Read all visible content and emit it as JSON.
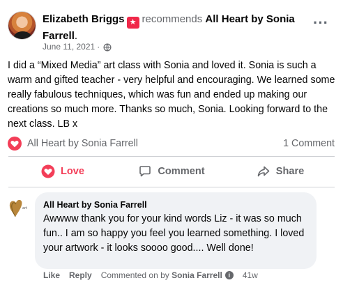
{
  "post": {
    "author_name": "Elizabeth Briggs",
    "verb": "recommends",
    "page_name": "All Heart by Sonia Farrell",
    "period": ".",
    "date": "June 11, 2021",
    "date_sep": "·",
    "body": "I did a “Mixed Media” art class with Sonia and loved it. Sonia is such a warm and gifted teacher - very helpful and encouraging. We learned some really fabulous techniques, which was fun and ended up making our creations so much more. Thanks so much, Sonia. Looking forward to the next class. LB x"
  },
  "stats": {
    "reactor": "All Heart by Sonia Farrell",
    "comment_count": "1 Comment"
  },
  "actions": {
    "love": "Love",
    "comment": "Comment",
    "share": "Share"
  },
  "comment": {
    "author": "All Heart by Sonia Farrell",
    "text": "Awwww thank you for your kind words Liz - it was so much fun.. I am so happy you feel you learned something. I loved your artwork - it looks soooo good.... Well done!",
    "like": "Like",
    "reply": "Reply",
    "commented_on_by": "Commented on by",
    "commenter": "Sonia Farrell",
    "age": "41w"
  },
  "colors": {
    "love": "#f33e58",
    "secondary_text": "#65676b",
    "bubble_bg": "#f0f2f5",
    "badge": "#f02849"
  }
}
